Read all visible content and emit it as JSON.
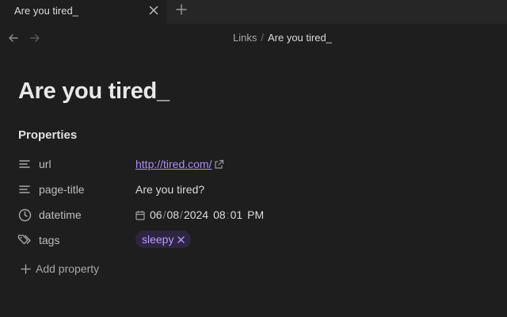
{
  "tabs": [
    {
      "title": "Are you tired_",
      "close_icon": "close-icon"
    }
  ],
  "new_tab_icon": "plus-icon",
  "nav": {
    "back_icon": "arrow-left-icon",
    "forward_icon": "arrow-right-icon"
  },
  "breadcrumb": {
    "parent": "Links",
    "separator": "/",
    "current": "Are you tired_"
  },
  "note": {
    "title": "Are you tired_"
  },
  "properties": {
    "heading": "Properties",
    "items": [
      {
        "icon": "text-lines-icon",
        "key": "url",
        "value": "http://tired.com/",
        "value_icon": "external-link-icon"
      },
      {
        "icon": "text-lines-icon",
        "key": "page-title",
        "value": "Are you tired?"
      },
      {
        "icon": "clock-icon",
        "key": "datetime",
        "date": {
          "month": "06",
          "day": "08",
          "year": "2024",
          "hour": "08",
          "minute": "01",
          "ampm": "PM"
        },
        "value_icon": "calendar-icon"
      },
      {
        "icon": "tags-icon",
        "key": "tags",
        "tags": [
          "sleepy"
        ]
      }
    ],
    "add_label": "Add property"
  },
  "colors": {
    "background": "#1e1e1e",
    "tabbar": "#262626",
    "accent": "#a98ef5",
    "tag_bg": "#2e2540"
  }
}
